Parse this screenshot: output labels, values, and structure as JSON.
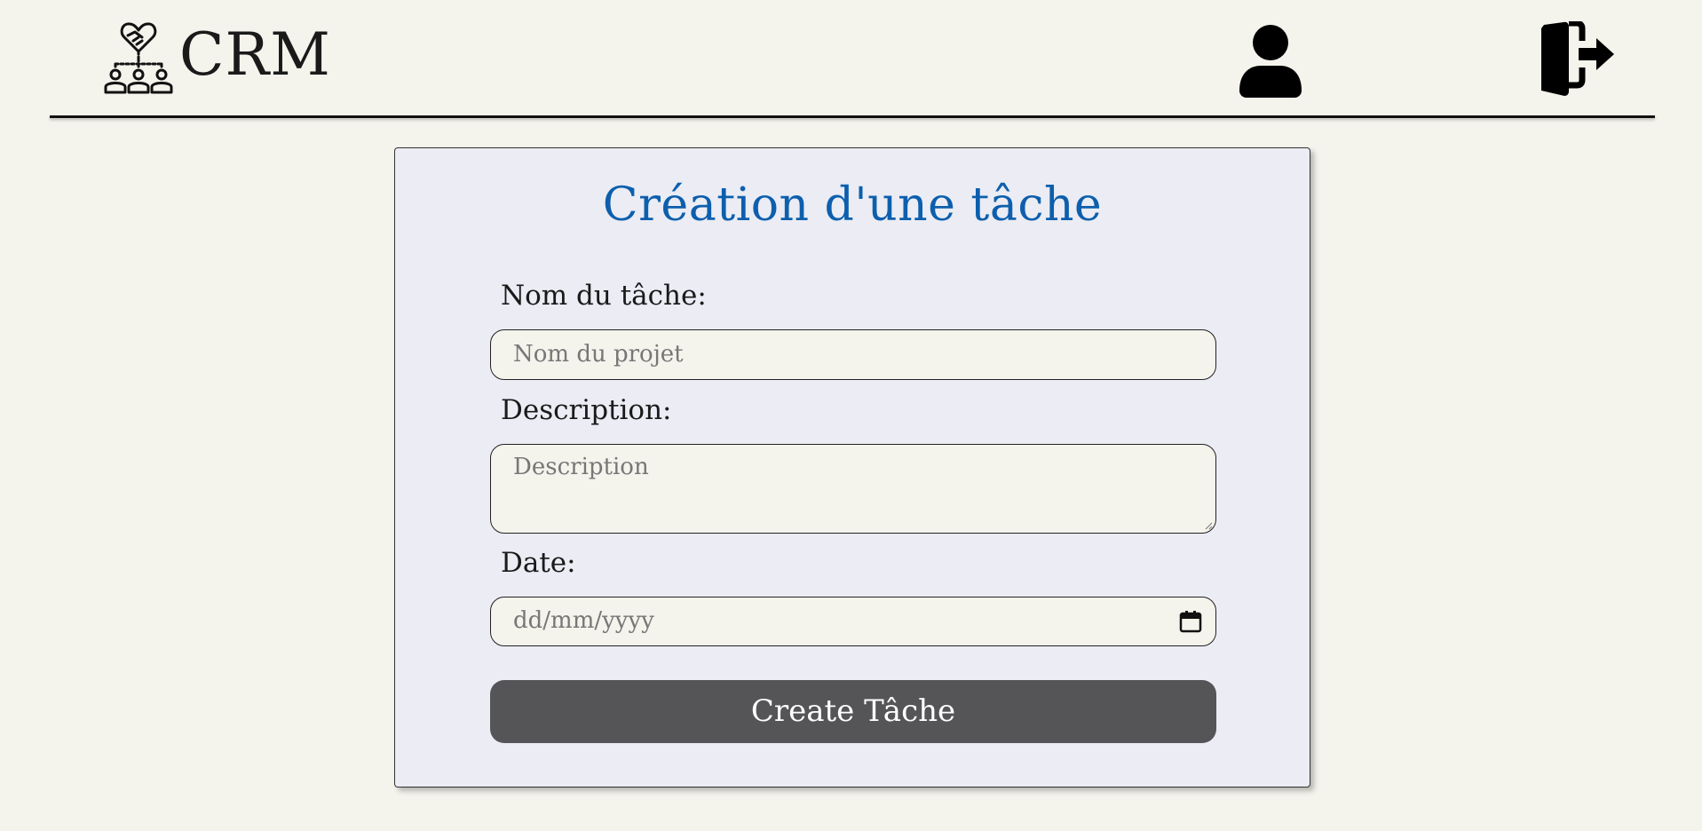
{
  "header": {
    "logo_text": "CRM",
    "logo_icon": "team-network-handshake-icon",
    "user_icon": "user-icon",
    "logout_icon": "logout-door-icon"
  },
  "form": {
    "title": "Création d'une tâche",
    "name_label": "Nom du tâche:",
    "name_placeholder": "Nom du projet",
    "description_label": "Description:",
    "description_placeholder": "Description",
    "date_label": "Date:",
    "date_placeholder": "dd/mm/yyyy",
    "submit_label": "Create Tâche"
  },
  "colors": {
    "background": "#f4f3ec",
    "card": "#ebecf4",
    "title": "#0d5fad",
    "button": "#555558"
  }
}
